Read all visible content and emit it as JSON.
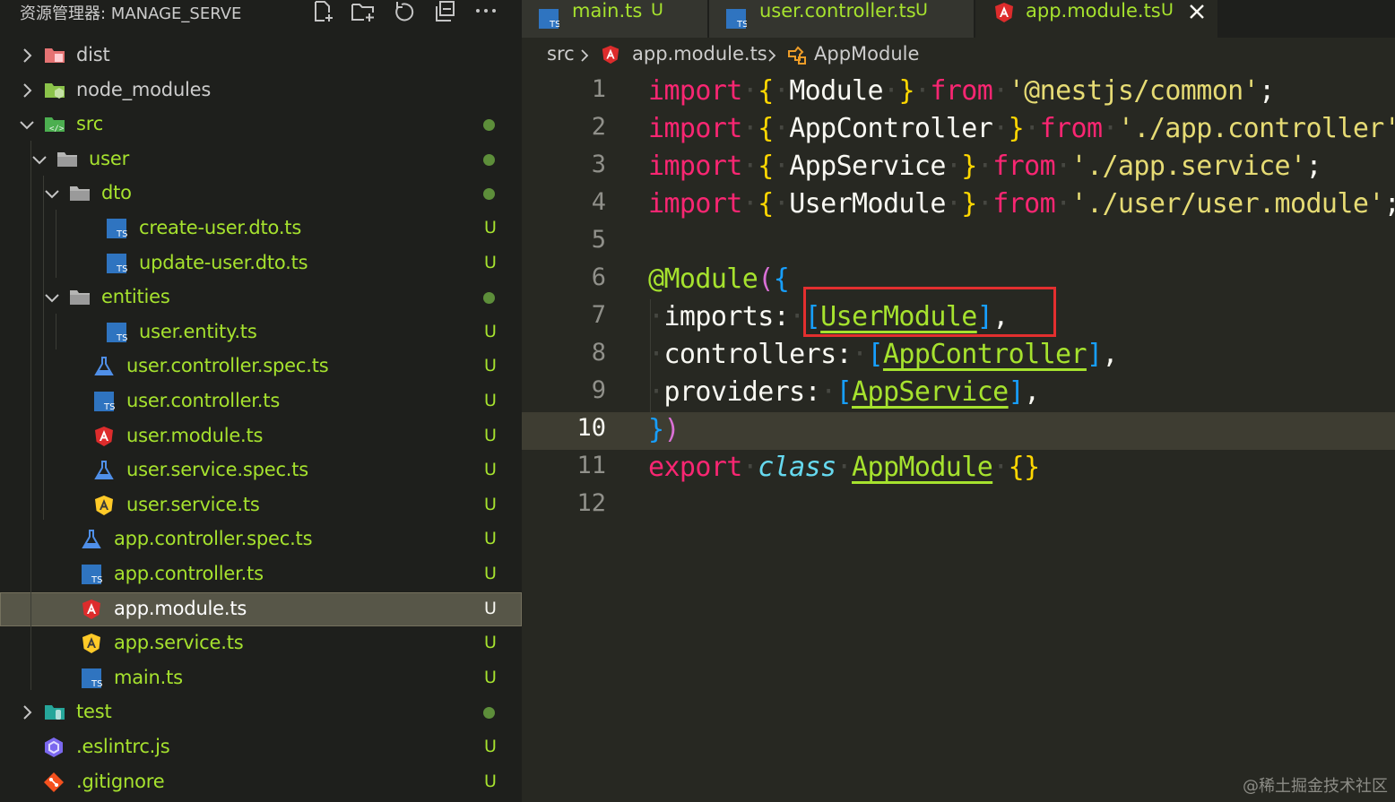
{
  "explorer": {
    "title": "资源管理器: MANAGE_SERVE",
    "actions": [
      "new-file-icon",
      "new-folder-icon",
      "refresh-icon",
      "collapse-all-icon",
      "more-icon"
    ],
    "items": [
      {
        "label": "dist",
        "kind": "folder",
        "icon": "folder-dist-icon",
        "color": "#cccccc",
        "indent": 0,
        "expanded": false,
        "status": ""
      },
      {
        "label": "node_modules",
        "kind": "folder",
        "icon": "folder-node-icon",
        "color": "#cccccc",
        "indent": 0,
        "expanded": false,
        "status": ""
      },
      {
        "label": "src",
        "kind": "folder",
        "icon": "folder-src-icon",
        "color": "#a6e22e",
        "indent": 0,
        "expanded": true,
        "status": "dot"
      },
      {
        "label": "user",
        "kind": "folder",
        "icon": "folder-icon",
        "color": "#a6e22e",
        "indent": 1,
        "expanded": true,
        "status": "dot"
      },
      {
        "label": "dto",
        "kind": "folder",
        "icon": "folder-icon",
        "color": "#a6e22e",
        "indent": 2,
        "expanded": true,
        "status": "dot"
      },
      {
        "label": "create-user.dto.ts",
        "kind": "file",
        "icon": "typescript-icon",
        "color": "#a6e22e",
        "indent": 3,
        "status": "U"
      },
      {
        "label": "update-user.dto.ts",
        "kind": "file",
        "icon": "typescript-icon",
        "color": "#a6e22e",
        "indent": 3,
        "status": "U"
      },
      {
        "label": "entities",
        "kind": "folder",
        "icon": "folder-icon",
        "color": "#a6e22e",
        "indent": 2,
        "expanded": true,
        "status": "dot"
      },
      {
        "label": "user.entity.ts",
        "kind": "file",
        "icon": "typescript-icon",
        "color": "#a6e22e",
        "indent": 3,
        "status": "U"
      },
      {
        "label": "user.controller.spec.ts",
        "kind": "file",
        "icon": "test-flask-icon",
        "color": "#a6e22e",
        "indent": 2,
        "status": "U"
      },
      {
        "label": "user.controller.ts",
        "kind": "file",
        "icon": "typescript-icon",
        "color": "#a6e22e",
        "indent": 2,
        "status": "U"
      },
      {
        "label": "user.module.ts",
        "kind": "file",
        "icon": "angular-icon",
        "color": "#a6e22e",
        "indent": 2,
        "status": "U"
      },
      {
        "label": "user.service.spec.ts",
        "kind": "file",
        "icon": "test-flask-icon",
        "color": "#a6e22e",
        "indent": 2,
        "status": "U"
      },
      {
        "label": "user.service.ts",
        "kind": "file",
        "icon": "angular-service-icon",
        "color": "#a6e22e",
        "indent": 2,
        "status": "U"
      },
      {
        "label": "app.controller.spec.ts",
        "kind": "file",
        "icon": "test-flask-icon",
        "color": "#a6e22e",
        "indent": 1,
        "status": "U"
      },
      {
        "label": "app.controller.ts",
        "kind": "file",
        "icon": "typescript-icon",
        "color": "#a6e22e",
        "indent": 1,
        "status": "U"
      },
      {
        "label": "app.module.ts",
        "kind": "file",
        "icon": "angular-icon",
        "color": "#ffffff",
        "indent": 1,
        "status": "U",
        "selected": true
      },
      {
        "label": "app.service.ts",
        "kind": "file",
        "icon": "angular-service-icon",
        "color": "#a6e22e",
        "indent": 1,
        "status": "U"
      },
      {
        "label": "main.ts",
        "kind": "file",
        "icon": "typescript-icon",
        "color": "#a6e22e",
        "indent": 1,
        "status": "U"
      },
      {
        "label": "test",
        "kind": "folder",
        "icon": "folder-test-icon",
        "color": "#a6e22e",
        "indent": 0,
        "expanded": false,
        "status": "dot"
      },
      {
        "label": ".eslintrc.js",
        "kind": "file",
        "icon": "eslint-icon",
        "color": "#a6e22e",
        "indent": 0,
        "status": "U"
      },
      {
        "label": ".gitignore",
        "kind": "file",
        "icon": "git-icon",
        "color": "#a6e22e",
        "indent": 0,
        "status": "U"
      }
    ]
  },
  "tabs": [
    {
      "label": "main.ts",
      "status": "U",
      "icon": "typescript-icon",
      "active": false
    },
    {
      "label": "user.controller.ts",
      "status": "U",
      "icon": "typescript-icon",
      "active": false
    },
    {
      "label": "app.module.ts",
      "status": "U",
      "icon": "angular-icon",
      "active": true
    }
  ],
  "breadcrumb": {
    "folder": "src",
    "file": "app.module.ts",
    "symbol": "AppModule"
  },
  "editor": {
    "current_line": 10,
    "lines": [
      {
        "n": "1"
      },
      {
        "n": "2"
      },
      {
        "n": "3"
      },
      {
        "n": "4"
      },
      {
        "n": "5"
      },
      {
        "n": "6"
      },
      {
        "n": "7"
      },
      {
        "n": "8"
      },
      {
        "n": "9"
      },
      {
        "n": "10"
      },
      {
        "n": "11"
      },
      {
        "n": "12"
      }
    ],
    "code": {
      "kw_import": "import",
      "kw_from": "from",
      "l1_name": "Module",
      "l1_path": "'@nestjs/common'",
      "l2_name": "AppController",
      "l2_path": "'./app.controller'",
      "l3_name": "AppService",
      "l3_path": "'./app.service'",
      "l4_name": "UserModule",
      "l4_path": "'./user/user.module'",
      "decorator": "@Module",
      "prop_imports": "imports",
      "val_imports": "UserModule",
      "prop_controllers": "controllers",
      "val_controllers": "AppController",
      "prop_providers": "providers",
      "val_providers": "AppService",
      "kw_export": "export",
      "kw_class": "class",
      "class_name": "AppModule"
    }
  },
  "watermark": "@稀土掘金技术社区"
}
